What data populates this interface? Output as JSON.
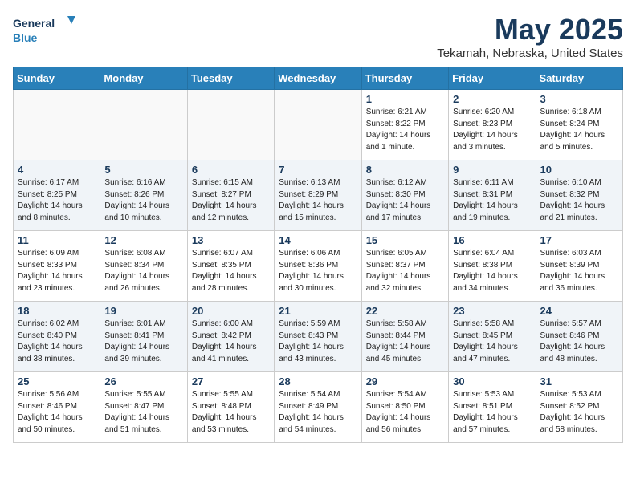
{
  "logo": {
    "line1": "General",
    "line2": "Blue"
  },
  "title": "May 2025",
  "subtitle": "Tekamah, Nebraska, United States",
  "weekdays": [
    "Sunday",
    "Monday",
    "Tuesday",
    "Wednesday",
    "Thursday",
    "Friday",
    "Saturday"
  ],
  "weeks": [
    [
      {
        "day": "",
        "info": ""
      },
      {
        "day": "",
        "info": ""
      },
      {
        "day": "",
        "info": ""
      },
      {
        "day": "",
        "info": ""
      },
      {
        "day": "1",
        "info": "Sunrise: 6:21 AM\nSunset: 8:22 PM\nDaylight: 14 hours and 1 minute."
      },
      {
        "day": "2",
        "info": "Sunrise: 6:20 AM\nSunset: 8:23 PM\nDaylight: 14 hours and 3 minutes."
      },
      {
        "day": "3",
        "info": "Sunrise: 6:18 AM\nSunset: 8:24 PM\nDaylight: 14 hours and 5 minutes."
      }
    ],
    [
      {
        "day": "4",
        "info": "Sunrise: 6:17 AM\nSunset: 8:25 PM\nDaylight: 14 hours and 8 minutes."
      },
      {
        "day": "5",
        "info": "Sunrise: 6:16 AM\nSunset: 8:26 PM\nDaylight: 14 hours and 10 minutes."
      },
      {
        "day": "6",
        "info": "Sunrise: 6:15 AM\nSunset: 8:27 PM\nDaylight: 14 hours and 12 minutes."
      },
      {
        "day": "7",
        "info": "Sunrise: 6:13 AM\nSunset: 8:29 PM\nDaylight: 14 hours and 15 minutes."
      },
      {
        "day": "8",
        "info": "Sunrise: 6:12 AM\nSunset: 8:30 PM\nDaylight: 14 hours and 17 minutes."
      },
      {
        "day": "9",
        "info": "Sunrise: 6:11 AM\nSunset: 8:31 PM\nDaylight: 14 hours and 19 minutes."
      },
      {
        "day": "10",
        "info": "Sunrise: 6:10 AM\nSunset: 8:32 PM\nDaylight: 14 hours and 21 minutes."
      }
    ],
    [
      {
        "day": "11",
        "info": "Sunrise: 6:09 AM\nSunset: 8:33 PM\nDaylight: 14 hours and 23 minutes."
      },
      {
        "day": "12",
        "info": "Sunrise: 6:08 AM\nSunset: 8:34 PM\nDaylight: 14 hours and 26 minutes."
      },
      {
        "day": "13",
        "info": "Sunrise: 6:07 AM\nSunset: 8:35 PM\nDaylight: 14 hours and 28 minutes."
      },
      {
        "day": "14",
        "info": "Sunrise: 6:06 AM\nSunset: 8:36 PM\nDaylight: 14 hours and 30 minutes."
      },
      {
        "day": "15",
        "info": "Sunrise: 6:05 AM\nSunset: 8:37 PM\nDaylight: 14 hours and 32 minutes."
      },
      {
        "day": "16",
        "info": "Sunrise: 6:04 AM\nSunset: 8:38 PM\nDaylight: 14 hours and 34 minutes."
      },
      {
        "day": "17",
        "info": "Sunrise: 6:03 AM\nSunset: 8:39 PM\nDaylight: 14 hours and 36 minutes."
      }
    ],
    [
      {
        "day": "18",
        "info": "Sunrise: 6:02 AM\nSunset: 8:40 PM\nDaylight: 14 hours and 38 minutes."
      },
      {
        "day": "19",
        "info": "Sunrise: 6:01 AM\nSunset: 8:41 PM\nDaylight: 14 hours and 39 minutes."
      },
      {
        "day": "20",
        "info": "Sunrise: 6:00 AM\nSunset: 8:42 PM\nDaylight: 14 hours and 41 minutes."
      },
      {
        "day": "21",
        "info": "Sunrise: 5:59 AM\nSunset: 8:43 PM\nDaylight: 14 hours and 43 minutes."
      },
      {
        "day": "22",
        "info": "Sunrise: 5:58 AM\nSunset: 8:44 PM\nDaylight: 14 hours and 45 minutes."
      },
      {
        "day": "23",
        "info": "Sunrise: 5:58 AM\nSunset: 8:45 PM\nDaylight: 14 hours and 47 minutes."
      },
      {
        "day": "24",
        "info": "Sunrise: 5:57 AM\nSunset: 8:46 PM\nDaylight: 14 hours and 48 minutes."
      }
    ],
    [
      {
        "day": "25",
        "info": "Sunrise: 5:56 AM\nSunset: 8:46 PM\nDaylight: 14 hours and 50 minutes."
      },
      {
        "day": "26",
        "info": "Sunrise: 5:55 AM\nSunset: 8:47 PM\nDaylight: 14 hours and 51 minutes."
      },
      {
        "day": "27",
        "info": "Sunrise: 5:55 AM\nSunset: 8:48 PM\nDaylight: 14 hours and 53 minutes."
      },
      {
        "day": "28",
        "info": "Sunrise: 5:54 AM\nSunset: 8:49 PM\nDaylight: 14 hours and 54 minutes."
      },
      {
        "day": "29",
        "info": "Sunrise: 5:54 AM\nSunset: 8:50 PM\nDaylight: 14 hours and 56 minutes."
      },
      {
        "day": "30",
        "info": "Sunrise: 5:53 AM\nSunset: 8:51 PM\nDaylight: 14 hours and 57 minutes."
      },
      {
        "day": "31",
        "info": "Sunrise: 5:53 AM\nSunset: 8:52 PM\nDaylight: 14 hours and 58 minutes."
      }
    ]
  ]
}
